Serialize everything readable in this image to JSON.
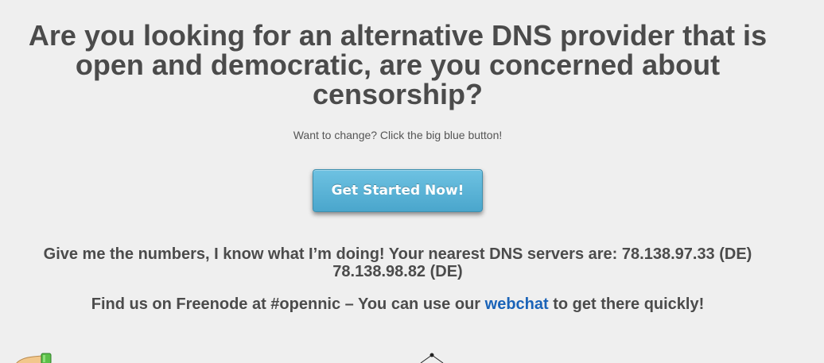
{
  "hero": {
    "headline": "Are you looking for an alternative DNS provider that is open and democratic, are you concerned about censorship?",
    "tagline": "Want to change? Click the big blue button!",
    "cta_label": "Get Started Now!"
  },
  "servers": {
    "intro": "Give me the numbers, I know what I’m doing! Your nearest DNS servers are:",
    "primary": "78.138.97.33 (DE)",
    "secondary": "78.138.98.82 (DE)"
  },
  "freenode": {
    "prefix": "Find us on Freenode at #opennic – You can use our",
    "link_label": "webchat",
    "suffix": "to get there quickly!"
  },
  "icons": {
    "left": "hand-icon",
    "center": "pin-icon"
  },
  "colors": {
    "background": "#efefef",
    "text": "#4b4b4b",
    "button": "#4aa6cc",
    "link": "#1a63b8"
  }
}
